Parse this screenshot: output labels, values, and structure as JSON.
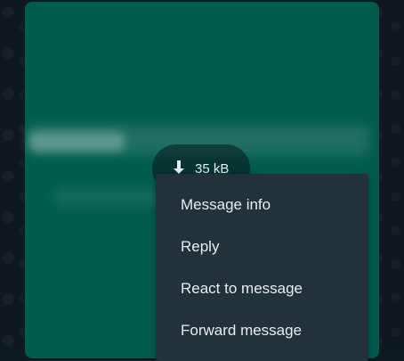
{
  "message": {
    "attachment": {
      "size_label": "35 kB",
      "icon": "download-icon"
    }
  },
  "context_menu": {
    "items": [
      {
        "label": "Message info"
      },
      {
        "label": "Reply"
      },
      {
        "label": "React to message"
      },
      {
        "label": "Forward message"
      }
    ]
  },
  "colors": {
    "bubble": "#005c4b",
    "menu_bg": "#233138",
    "menu_text": "#e9edef",
    "wallpaper": "#0e181d"
  }
}
